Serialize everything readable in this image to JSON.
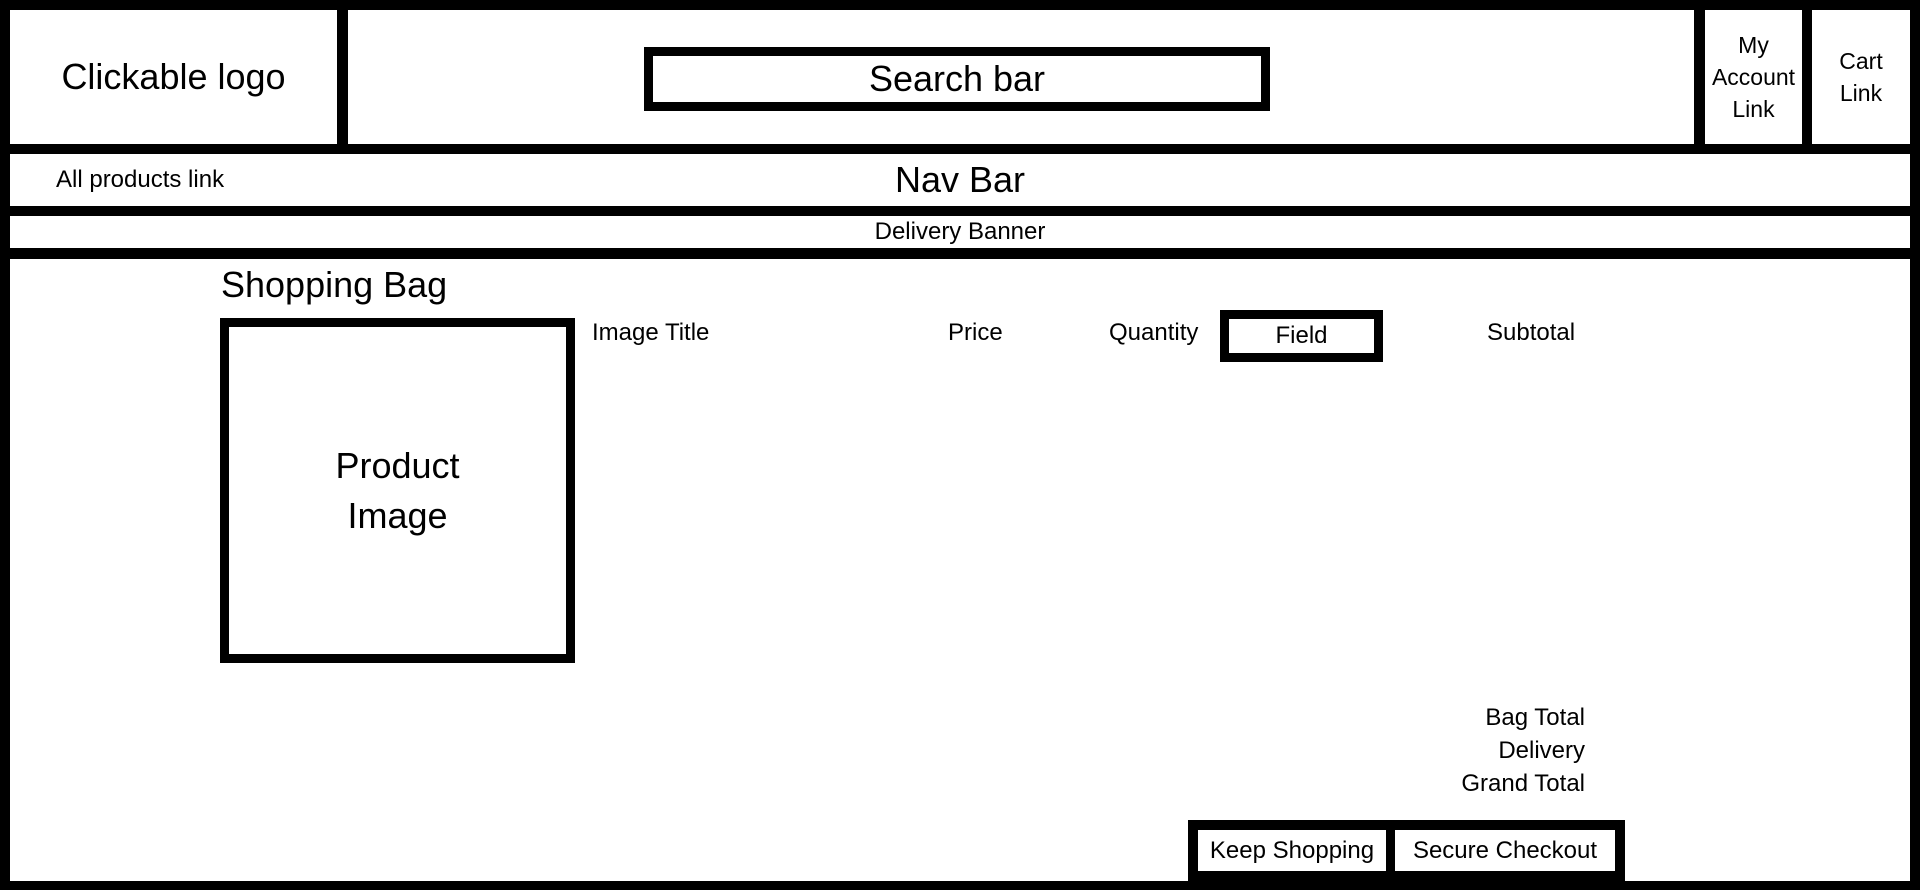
{
  "header": {
    "logo_label": "Clickable logo",
    "search_label": "Search bar",
    "account_link": [
      "My",
      "Account",
      "Link"
    ],
    "cart_link": [
      "Cart",
      "Link"
    ]
  },
  "nav": {
    "all_products_label": "All products link",
    "title": "Nav Bar"
  },
  "banner": {
    "text": "Delivery Banner"
  },
  "main": {
    "title": "Shopping Bag",
    "product_image_label": [
      "Product",
      "Image"
    ],
    "columns": {
      "image_title": "Image Title",
      "price": "Price",
      "quantity": "Quantity",
      "quantity_field": "Field",
      "subtotal": "Subtotal"
    },
    "totals": [
      "Bag Total",
      "Delivery",
      "Grand Total"
    ],
    "buttons": {
      "keep_shopping": "Keep Shopping",
      "secure_checkout": "Secure Checkout"
    }
  }
}
